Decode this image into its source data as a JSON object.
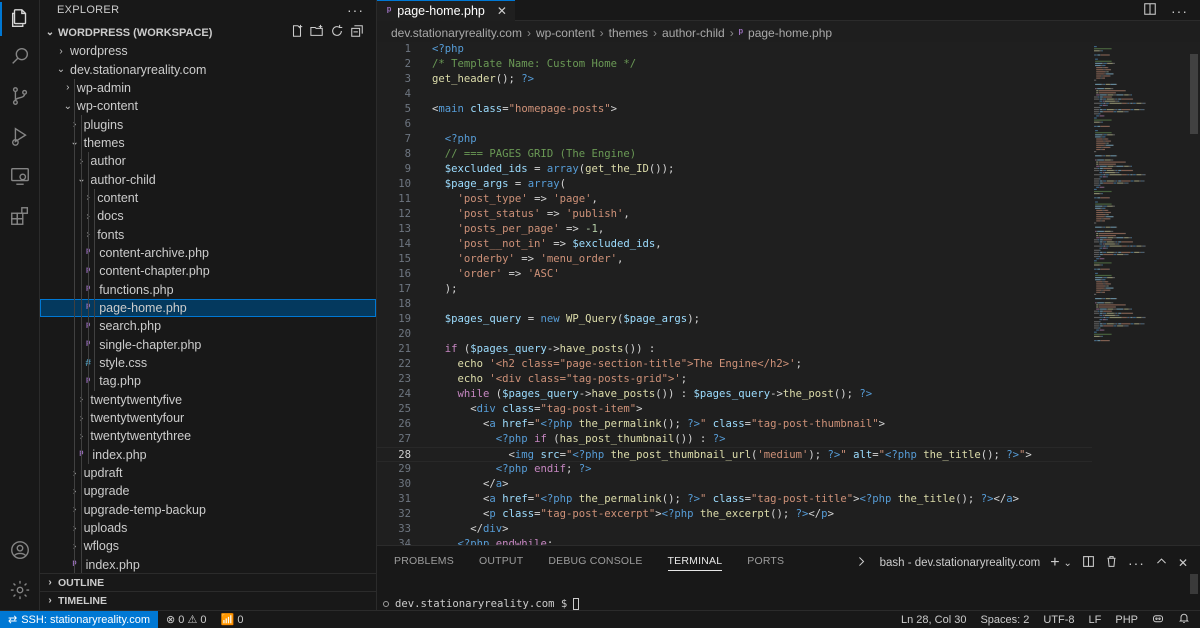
{
  "sidebar": {
    "title": "EXPLORER",
    "workspace": "WORDPRESS (WORKSPACE)",
    "outline": "OUTLINE",
    "timeline": "TIMELINE",
    "tree": [
      {
        "label": "wordpress",
        "type": "folder",
        "open": false,
        "depth": 0
      },
      {
        "label": "dev.stationaryreality.com",
        "type": "folder",
        "open": true,
        "depth": 0
      },
      {
        "label": "wp-admin",
        "type": "folder",
        "open": false,
        "depth": 1
      },
      {
        "label": "wp-content",
        "type": "folder",
        "open": true,
        "depth": 1
      },
      {
        "label": "plugins",
        "type": "folder",
        "open": false,
        "depth": 2
      },
      {
        "label": "themes",
        "type": "folder",
        "open": true,
        "depth": 2
      },
      {
        "label": "author",
        "type": "folder",
        "open": false,
        "depth": 3
      },
      {
        "label": "author-child",
        "type": "folder",
        "open": true,
        "depth": 3
      },
      {
        "label": "content",
        "type": "folder",
        "open": false,
        "depth": 4
      },
      {
        "label": "docs",
        "type": "folder",
        "open": false,
        "depth": 4
      },
      {
        "label": "fonts",
        "type": "folder",
        "open": false,
        "depth": 4
      },
      {
        "label": "content-archive.php",
        "type": "php",
        "depth": 4
      },
      {
        "label": "content-chapter.php",
        "type": "php",
        "depth": 4
      },
      {
        "label": "functions.php",
        "type": "php",
        "depth": 4
      },
      {
        "label": "page-home.php",
        "type": "php",
        "depth": 4,
        "selected": true
      },
      {
        "label": "search.php",
        "type": "php",
        "depth": 4
      },
      {
        "label": "single-chapter.php",
        "type": "php",
        "depth": 4
      },
      {
        "label": "style.css",
        "type": "css",
        "depth": 4
      },
      {
        "label": "tag.php",
        "type": "php",
        "depth": 4
      },
      {
        "label": "twentytwentyfive",
        "type": "folder",
        "open": false,
        "depth": 3
      },
      {
        "label": "twentytwentyfour",
        "type": "folder",
        "open": false,
        "depth": 3
      },
      {
        "label": "twentytwentythree",
        "type": "folder",
        "open": false,
        "depth": 3
      },
      {
        "label": "index.php",
        "type": "php",
        "depth": 3
      },
      {
        "label": "updraft",
        "type": "folder",
        "open": false,
        "depth": 2
      },
      {
        "label": "upgrade",
        "type": "folder",
        "open": false,
        "depth": 2
      },
      {
        "label": "upgrade-temp-backup",
        "type": "folder",
        "open": false,
        "depth": 2
      },
      {
        "label": "uploads",
        "type": "folder",
        "open": false,
        "depth": 2
      },
      {
        "label": "wflogs",
        "type": "folder",
        "open": false,
        "depth": 2
      },
      {
        "label": "index.php",
        "type": "php",
        "depth": 2
      }
    ]
  },
  "editor": {
    "tab_label": "page-home.php",
    "breadcrumb": [
      "dev.stationaryreality.com",
      "wp-content",
      "themes",
      "author-child",
      "page-home.php"
    ],
    "current_line": 28,
    "lines": [
      {
        "n": "1",
        "parts": [
          [
            "<?php",
            "k"
          ]
        ]
      },
      {
        "n": "2",
        "parts": [
          [
            "/* Template Name: Custom Home */",
            "c"
          ]
        ]
      },
      {
        "n": "3",
        "parts": [
          [
            "get_header",
            "f"
          ],
          [
            "(); ",
            "p"
          ],
          [
            "?>",
            "k"
          ]
        ]
      },
      {
        "n": "4",
        "parts": []
      },
      {
        "n": "5",
        "parts": [
          [
            "<",
            "p"
          ],
          [
            "main",
            "t"
          ],
          [
            " ",
            "p"
          ],
          [
            "class",
            "a"
          ],
          [
            "=",
            "p"
          ],
          [
            "\"homepage-posts\"",
            "s"
          ],
          [
            ">",
            "p"
          ]
        ]
      },
      {
        "n": "6",
        "parts": []
      },
      {
        "n": "7",
        "parts": [
          [
            "  ",
            "p"
          ],
          [
            "<?php",
            "k"
          ]
        ]
      },
      {
        "n": "8",
        "parts": [
          [
            "  ",
            "p"
          ],
          [
            "// === PAGES GRID (The Engine)",
            "c"
          ]
        ]
      },
      {
        "n": "9",
        "parts": [
          [
            "  ",
            "p"
          ],
          [
            "$excluded_ids",
            "v"
          ],
          [
            " = ",
            "p"
          ],
          [
            "array",
            "k"
          ],
          [
            "(",
            "p"
          ],
          [
            "get_the_ID",
            "f"
          ],
          [
            "());",
            "p"
          ]
        ]
      },
      {
        "n": "10",
        "parts": [
          [
            "  ",
            "p"
          ],
          [
            "$page_args",
            "v"
          ],
          [
            " = ",
            "p"
          ],
          [
            "array",
            "k"
          ],
          [
            "(",
            "p"
          ]
        ]
      },
      {
        "n": "11",
        "parts": [
          [
            "    ",
            "p"
          ],
          [
            "'post_type'",
            "s"
          ],
          [
            " => ",
            "p"
          ],
          [
            "'page'",
            "s"
          ],
          [
            ",",
            "p"
          ]
        ]
      },
      {
        "n": "12",
        "parts": [
          [
            "    ",
            "p"
          ],
          [
            "'post_status'",
            "s"
          ],
          [
            " => ",
            "p"
          ],
          [
            "'publish'",
            "s"
          ],
          [
            ",",
            "p"
          ]
        ]
      },
      {
        "n": "13",
        "parts": [
          [
            "    ",
            "p"
          ],
          [
            "'posts_per_page'",
            "s"
          ],
          [
            " => ",
            "p"
          ],
          [
            "-1",
            "n"
          ],
          [
            ",",
            "p"
          ]
        ]
      },
      {
        "n": "14",
        "parts": [
          [
            "    ",
            "p"
          ],
          [
            "'post__not_in'",
            "s"
          ],
          [
            " => ",
            "p"
          ],
          [
            "$excluded_ids",
            "v"
          ],
          [
            ",",
            "p"
          ]
        ]
      },
      {
        "n": "15",
        "parts": [
          [
            "    ",
            "p"
          ],
          [
            "'orderby'",
            "s"
          ],
          [
            " => ",
            "p"
          ],
          [
            "'menu_order'",
            "s"
          ],
          [
            ",",
            "p"
          ]
        ]
      },
      {
        "n": "16",
        "parts": [
          [
            "    ",
            "p"
          ],
          [
            "'order'",
            "s"
          ],
          [
            " => ",
            "p"
          ],
          [
            "'ASC'",
            "s"
          ]
        ]
      },
      {
        "n": "17",
        "parts": [
          [
            "  );",
            "p"
          ]
        ]
      },
      {
        "n": "18",
        "parts": []
      },
      {
        "n": "19",
        "parts": [
          [
            "  ",
            "p"
          ],
          [
            "$pages_query",
            "v"
          ],
          [
            " = ",
            "p"
          ],
          [
            "new",
            "k"
          ],
          [
            " ",
            "p"
          ],
          [
            "WP_Query",
            "f"
          ],
          [
            "(",
            "p"
          ],
          [
            "$page_args",
            "v"
          ],
          [
            ");",
            "p"
          ]
        ]
      },
      {
        "n": "20",
        "parts": []
      },
      {
        "n": "21",
        "parts": [
          [
            "  ",
            "p"
          ],
          [
            "if",
            "kk"
          ],
          [
            " (",
            "p"
          ],
          [
            "$pages_query",
            "v"
          ],
          [
            "->",
            "p"
          ],
          [
            "have_posts",
            "f"
          ],
          [
            "()) :",
            "p"
          ]
        ]
      },
      {
        "n": "22",
        "parts": [
          [
            "    ",
            "p"
          ],
          [
            "echo",
            "f"
          ],
          [
            " ",
            "p"
          ],
          [
            "'<h2 class=\"page-section-title\">The Engine</h2>'",
            "s"
          ],
          [
            ";",
            "p"
          ]
        ]
      },
      {
        "n": "23",
        "parts": [
          [
            "    ",
            "p"
          ],
          [
            "echo",
            "f"
          ],
          [
            " ",
            "p"
          ],
          [
            "'<div class=\"tag-posts-grid\">'",
            "s"
          ],
          [
            ";",
            "p"
          ]
        ]
      },
      {
        "n": "24",
        "parts": [
          [
            "    ",
            "p"
          ],
          [
            "while",
            "kk"
          ],
          [
            " (",
            "p"
          ],
          [
            "$pages_query",
            "v"
          ],
          [
            "->",
            "p"
          ],
          [
            "have_posts",
            "f"
          ],
          [
            "()) : ",
            "p"
          ],
          [
            "$pages_query",
            "v"
          ],
          [
            "->",
            "p"
          ],
          [
            "the_post",
            "f"
          ],
          [
            "(); ",
            "p"
          ],
          [
            "?>",
            "k"
          ]
        ]
      },
      {
        "n": "25",
        "parts": [
          [
            "      <",
            "p"
          ],
          [
            "div",
            "t"
          ],
          [
            " ",
            "p"
          ],
          [
            "class",
            "a"
          ],
          [
            "=",
            "p"
          ],
          [
            "\"tag-post-item\"",
            "s"
          ],
          [
            ">",
            "p"
          ]
        ]
      },
      {
        "n": "26",
        "parts": [
          [
            "        <",
            "p"
          ],
          [
            "a",
            "t"
          ],
          [
            " ",
            "p"
          ],
          [
            "href",
            "a"
          ],
          [
            "=",
            "p"
          ],
          [
            "\"",
            "s"
          ],
          [
            "<?php",
            "k"
          ],
          [
            " ",
            "p"
          ],
          [
            "the_permalink",
            "f"
          ],
          [
            "(); ",
            "p"
          ],
          [
            "?>",
            "k"
          ],
          [
            "\"",
            "s"
          ],
          [
            " ",
            "p"
          ],
          [
            "class",
            "a"
          ],
          [
            "=",
            "p"
          ],
          [
            "\"tag-post-thumbnail\"",
            "s"
          ],
          [
            ">",
            "p"
          ]
        ]
      },
      {
        "n": "27",
        "parts": [
          [
            "          ",
            "p"
          ],
          [
            "<?php",
            "k"
          ],
          [
            " ",
            "p"
          ],
          [
            "if",
            "kk"
          ],
          [
            " (",
            "p"
          ],
          [
            "has_post_thumbnail",
            "f"
          ],
          [
            "()) : ",
            "p"
          ],
          [
            "?>",
            "k"
          ]
        ]
      },
      {
        "n": "28",
        "parts": [
          [
            "            <",
            "p"
          ],
          [
            "img",
            "t"
          ],
          [
            " ",
            "p"
          ],
          [
            "src",
            "a"
          ],
          [
            "=",
            "p"
          ],
          [
            "\"",
            "s"
          ],
          [
            "<?php",
            "k"
          ],
          [
            " ",
            "p"
          ],
          [
            "the_post_thumbnail_url",
            "f"
          ],
          [
            "(",
            "p"
          ],
          [
            "'medium'",
            "s"
          ],
          [
            "); ",
            "p"
          ],
          [
            "?>",
            "k"
          ],
          [
            "\"",
            "s"
          ],
          [
            " ",
            "p"
          ],
          [
            "alt",
            "a"
          ],
          [
            "=",
            "p"
          ],
          [
            "\"",
            "s"
          ],
          [
            "<?php",
            "k"
          ],
          [
            " ",
            "p"
          ],
          [
            "the_title",
            "f"
          ],
          [
            "(); ",
            "p"
          ],
          [
            "?>",
            "k"
          ],
          [
            "\"",
            "s"
          ],
          [
            ">",
            "p"
          ]
        ]
      },
      {
        "n": "29",
        "parts": [
          [
            "          ",
            "p"
          ],
          [
            "<?php",
            "k"
          ],
          [
            " ",
            "p"
          ],
          [
            "endif",
            "kk"
          ],
          [
            "; ",
            "p"
          ],
          [
            "?>",
            "k"
          ]
        ]
      },
      {
        "n": "30",
        "parts": [
          [
            "        </",
            "p"
          ],
          [
            "a",
            "t"
          ],
          [
            ">",
            "p"
          ]
        ]
      },
      {
        "n": "31",
        "parts": [
          [
            "        <",
            "p"
          ],
          [
            "a",
            "t"
          ],
          [
            " ",
            "p"
          ],
          [
            "href",
            "a"
          ],
          [
            "=",
            "p"
          ],
          [
            "\"",
            "s"
          ],
          [
            "<?php",
            "k"
          ],
          [
            " ",
            "p"
          ],
          [
            "the_permalink",
            "f"
          ],
          [
            "(); ",
            "p"
          ],
          [
            "?>",
            "k"
          ],
          [
            "\"",
            "s"
          ],
          [
            " ",
            "p"
          ],
          [
            "class",
            "a"
          ],
          [
            "=",
            "p"
          ],
          [
            "\"tag-post-title\"",
            "s"
          ],
          [
            ">",
            "p"
          ],
          [
            "<?php",
            "k"
          ],
          [
            " ",
            "p"
          ],
          [
            "the_title",
            "f"
          ],
          [
            "(); ",
            "p"
          ],
          [
            "?>",
            "k"
          ],
          [
            "</",
            "p"
          ],
          [
            "a",
            "t"
          ],
          [
            ">",
            "p"
          ]
        ]
      },
      {
        "n": "32",
        "parts": [
          [
            "        <",
            "p"
          ],
          [
            "p",
            "t"
          ],
          [
            " ",
            "p"
          ],
          [
            "class",
            "a"
          ],
          [
            "=",
            "p"
          ],
          [
            "\"tag-post-excerpt\"",
            "s"
          ],
          [
            ">",
            "p"
          ],
          [
            "<?php",
            "k"
          ],
          [
            " ",
            "p"
          ],
          [
            "the_excerpt",
            "f"
          ],
          [
            "(); ",
            "p"
          ],
          [
            "?>",
            "k"
          ],
          [
            "</",
            "p"
          ],
          [
            "p",
            "t"
          ],
          [
            ">",
            "p"
          ]
        ]
      },
      {
        "n": "33",
        "parts": [
          [
            "      </",
            "p"
          ],
          [
            "div",
            "t"
          ],
          [
            ">",
            "p"
          ]
        ]
      },
      {
        "n": "34",
        "parts": [
          [
            "    ",
            "p"
          ],
          [
            "<?php",
            "k"
          ],
          [
            " ",
            "p"
          ],
          [
            "endwhile",
            "kk"
          ],
          [
            ";",
            "p"
          ]
        ]
      }
    ]
  },
  "panel": {
    "tabs": [
      "PROBLEMS",
      "OUTPUT",
      "DEBUG CONSOLE",
      "TERMINAL",
      "PORTS"
    ],
    "active_tab": "TERMINAL",
    "terminal_name": "bash - dev.stationaryreality.com",
    "prompt": "dev.stationaryreality.com $"
  },
  "status": {
    "remote": "SSH: stationaryreality.com",
    "errors": "0",
    "warnings": "0",
    "ports": "0",
    "position": "Ln 28, Col 30",
    "spaces": "Spaces: 2",
    "encoding": "UTF-8",
    "eol": "LF",
    "language": "PHP"
  },
  "colors": {
    "accent": "#0078d4",
    "php_icon": "#a074c4",
    "css_icon": "#519aba"
  }
}
